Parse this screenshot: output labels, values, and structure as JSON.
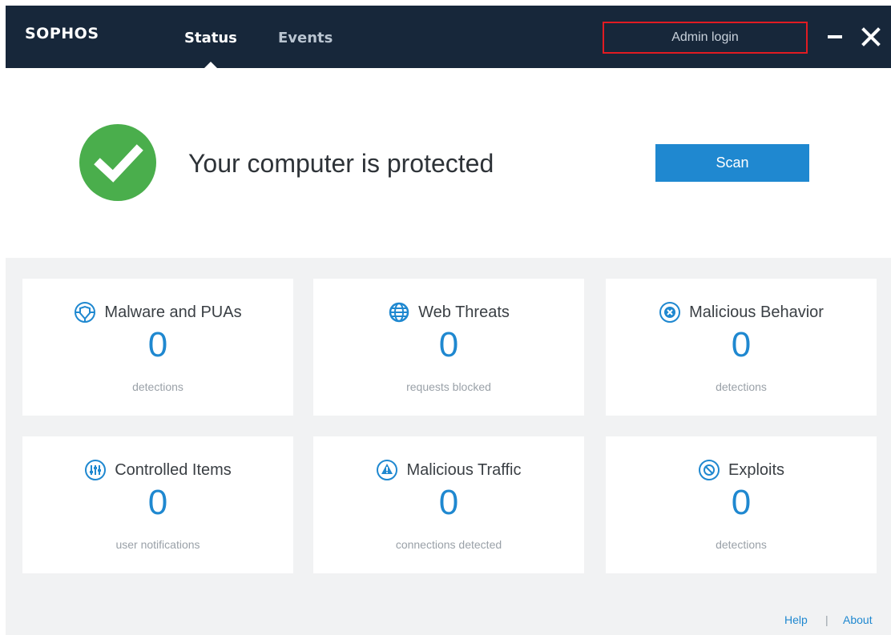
{
  "app": {
    "brand": "SOPHOS"
  },
  "tabs": [
    {
      "label": "Status",
      "active": true
    },
    {
      "label": "Events",
      "active": false
    }
  ],
  "header": {
    "admin_login_label": "Admin login"
  },
  "hero": {
    "status_icon": "check-circle-icon",
    "status_text": "Your computer is protected",
    "scan_label": "Scan"
  },
  "cards": [
    {
      "icon": "shield-icon",
      "title": "Malware and PUAs",
      "count": "0",
      "subtitle": "detections"
    },
    {
      "icon": "globe-icon",
      "title": "Web Threats",
      "count": "0",
      "subtitle": "requests blocked"
    },
    {
      "icon": "x-circle-icon",
      "title": "Malicious Behavior",
      "count": "0",
      "subtitle": "detections"
    },
    {
      "icon": "sliders-icon",
      "title": "Controlled Items",
      "count": "0",
      "subtitle": "user notifications"
    },
    {
      "icon": "warning-icon",
      "title": "Malicious Traffic",
      "count": "0",
      "subtitle": "connections detected"
    },
    {
      "icon": "no-entry-icon",
      "title": "Exploits",
      "count": "0",
      "subtitle": "detections"
    }
  ],
  "footer": {
    "help_label": "Help",
    "separator": "|",
    "about_label": "About"
  },
  "colors": {
    "titlebar": "#17273a",
    "accent": "#1f88d0",
    "success": "#4aae4c",
    "highlight_border": "#e11b22"
  }
}
